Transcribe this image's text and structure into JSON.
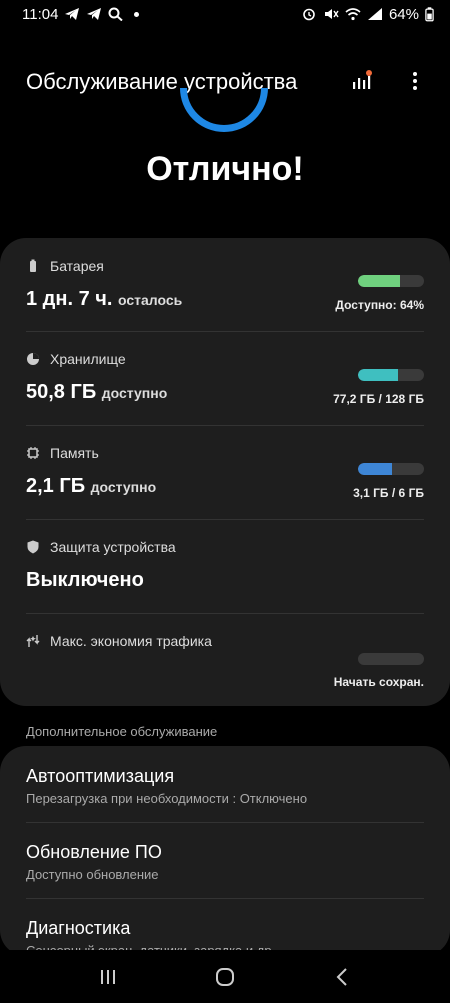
{
  "status_bar": {
    "time": "11:04",
    "battery": "64%",
    "left_icons": [
      "telegram-icon",
      "telegram-icon",
      "search-icon"
    ],
    "right_icons": [
      "alarm-icon",
      "mute-icon",
      "wifi-icon",
      "signal-icon"
    ]
  },
  "header": {
    "title": "Обслуживание устройства",
    "actions": [
      "chart-icon",
      "more-icon"
    ]
  },
  "overall": {
    "status": "Отлично!",
    "accent": "#1e88e5"
  },
  "rows": [
    {
      "icon": "battery-icon",
      "label": "Батарея",
      "value": "1 дн. 7 ч.",
      "suffix": "осталось",
      "caption": "Доступно: 64%",
      "fill": 0.64,
      "color": "#6fd07e"
    },
    {
      "icon": "pie-icon",
      "label": "Хранилище",
      "value": "50,8 ГБ",
      "suffix": "доступно",
      "caption": "77,2 ГБ / 128 ГБ",
      "fill": 0.6,
      "color": "#3fbfc0"
    },
    {
      "icon": "memory-icon",
      "label": "Память",
      "value": "2,1 ГБ",
      "suffix": "доступно",
      "caption": "3,1 ГБ / 6 ГБ",
      "fill": 0.52,
      "color": "#3e86d6"
    },
    {
      "icon": "shield-icon",
      "label": "Защита устройства",
      "value": "Выключено",
      "suffix": "",
      "caption": "",
      "fill": null,
      "color": ""
    },
    {
      "icon": "data-saver-icon",
      "label": "Макс. экономия трафика",
      "value": "",
      "suffix": "",
      "caption": "Начать сохран.",
      "fill": 0,
      "color": "#555"
    }
  ],
  "extra_section_label": "Дополнительное обслуживание",
  "extra_items": [
    {
      "title": "Автооптимизация",
      "subtitle": "Перезагрузка при необходимости : Отключено"
    },
    {
      "title": "Обновление ПО",
      "subtitle": "Доступно обновление"
    },
    {
      "title": "Диагностика",
      "subtitle": "Сенсорный экран, датчики, зарядка и др."
    }
  ],
  "nav": [
    "recents-icon",
    "home-icon",
    "back-icon"
  ]
}
